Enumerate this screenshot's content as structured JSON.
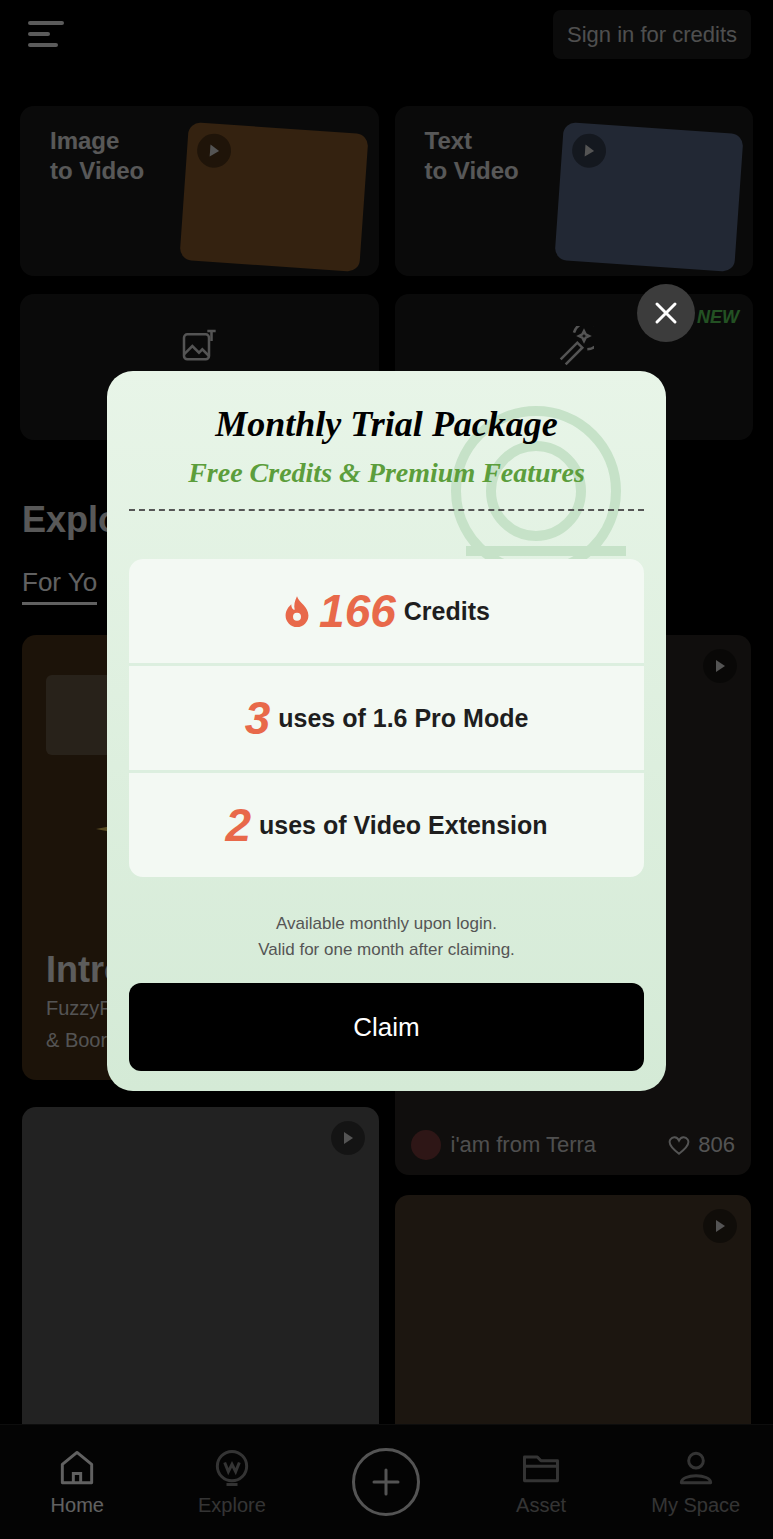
{
  "header": {
    "sign_in_button": "Sign in for credits"
  },
  "feature_cards": [
    {
      "label_lines": [
        "Image",
        "to Video"
      ]
    },
    {
      "label_lines": [
        "Text",
        "to Video"
      ]
    }
  ],
  "tool_cards": [
    {
      "kind": "image-text",
      "badge": ""
    },
    {
      "kind": "magic-edit",
      "badge": "NEW"
    }
  ],
  "explore": {
    "heading": "Explo",
    "tabs": [
      {
        "label": "For Yo",
        "selected": true
      }
    ]
  },
  "feed": {
    "left": [
      {
        "title": "Intro",
        "subtitle_lines": [
          "FuzzyF",
          "& Boor"
        ]
      },
      {
        "title": "",
        "subtitle_lines": []
      }
    ],
    "right": [
      {
        "author": "i'am from Terra",
        "likes": "806"
      },
      {
        "author": "",
        "likes": ""
      }
    ]
  },
  "modal": {
    "title": "Monthly Trial Package",
    "subtitle": "Free Credits & Premium Features",
    "perks": [
      {
        "kind": "credits",
        "value": "166",
        "label": "Credits"
      },
      {
        "kind": "uses",
        "value": "3",
        "label": "uses of 1.6 Pro Mode"
      },
      {
        "kind": "uses",
        "value": "2",
        "label": "uses of Video Extension"
      }
    ],
    "notes": [
      "Available monthly upon login.",
      "Valid for one month after claiming."
    ],
    "claim_button": "Claim"
  },
  "nav": [
    {
      "kind": "home",
      "label": "Home",
      "selected": true
    },
    {
      "kind": "explore",
      "label": "Explore",
      "selected": false
    },
    {
      "kind": "create",
      "label": "",
      "selected": false
    },
    {
      "kind": "asset",
      "label": "Asset",
      "selected": false
    },
    {
      "kind": "space",
      "label": "My Space",
      "selected": false
    }
  ]
}
